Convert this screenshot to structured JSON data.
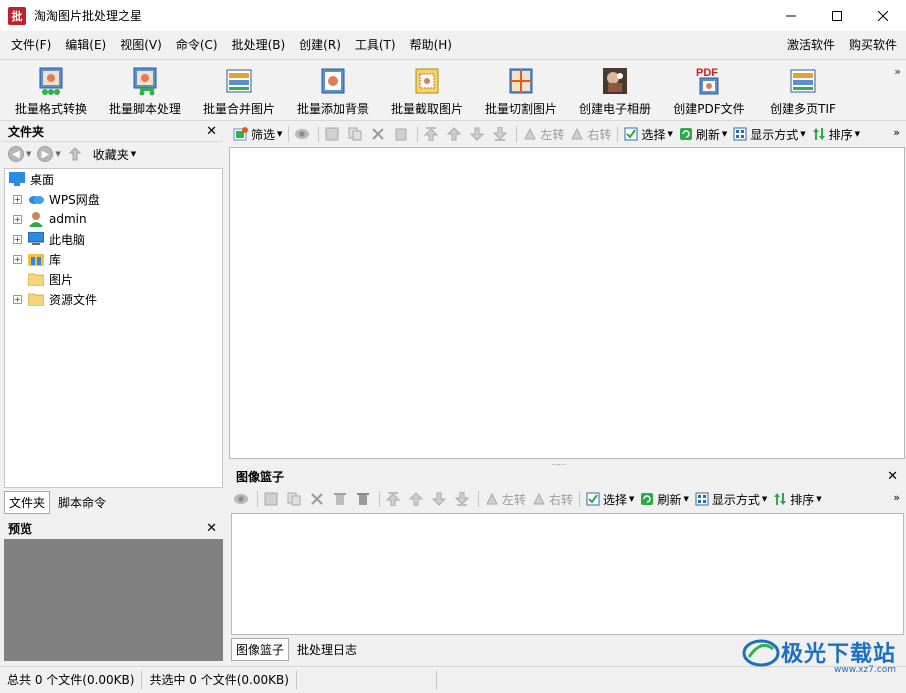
{
  "window": {
    "title": "淘淘图片批处理之星",
    "logo_text": "批",
    "minimize": "minimize",
    "maximize": "maximize",
    "close": "close"
  },
  "menu": {
    "items": [
      "文件(F)",
      "编辑(E)",
      "视图(V)",
      "命令(C)",
      "批处理(B)",
      "创建(R)",
      "工具(T)",
      "帮助(H)"
    ],
    "right": [
      "激活软件",
      "购买软件"
    ]
  },
  "main_toolbar": {
    "buttons": [
      {
        "label": "批量格式转换",
        "icon": "format-convert-icon"
      },
      {
        "label": "批量脚本处理",
        "icon": "script-process-icon"
      },
      {
        "label": "批量合并图片",
        "icon": "merge-images-icon"
      },
      {
        "label": "批量添加背景",
        "icon": "add-background-icon"
      },
      {
        "label": "批量截取图片",
        "icon": "crop-images-icon"
      },
      {
        "label": "批量切割图片",
        "icon": "cut-images-icon"
      },
      {
        "label": "创建电子相册",
        "icon": "photo-album-icon"
      },
      {
        "label": "创建PDF文件",
        "icon": "pdf-icon"
      },
      {
        "label": "创建多页TIF",
        "icon": "multipage-tif-icon"
      }
    ],
    "more": "»"
  },
  "folder_panel": {
    "title": "文件夹",
    "favorites": "收藏夹",
    "tree": [
      {
        "label": "桌面",
        "icon": "desktop-icon",
        "expandable": false,
        "root": true
      },
      {
        "label": "WPS网盘",
        "icon": "cloud-icon",
        "expandable": true
      },
      {
        "label": "admin",
        "icon": "user-icon",
        "expandable": true
      },
      {
        "label": "此电脑",
        "icon": "computer-icon",
        "expandable": true
      },
      {
        "label": "库",
        "icon": "library-icon",
        "expandable": true
      },
      {
        "label": "图片",
        "icon": "folder-icon",
        "expandable": false
      },
      {
        "label": "资源文件",
        "icon": "folder-icon",
        "expandable": true
      }
    ],
    "tabs": [
      "文件夹",
      "脚本命令"
    ]
  },
  "preview_panel": {
    "title": "预览"
  },
  "file_toolbar": {
    "filter": "筛选",
    "rotate_left": "左转",
    "rotate_right": "右转",
    "select": "选择",
    "refresh": "刷新",
    "display_mode": "显示方式",
    "sort": "排序",
    "more": "»"
  },
  "basket_panel": {
    "title": "图像篮子",
    "rotate_left": "左转",
    "rotate_right": "右转",
    "select": "选择",
    "refresh": "刷新",
    "display_mode": "显示方式",
    "sort": "排序",
    "more": "»",
    "tabs": [
      "图像篮子",
      "批处理日志"
    ]
  },
  "statusbar": {
    "total": "总共 0 个文件(0.00KB)",
    "selected": "共选中 0 个文件(0.00KB)"
  },
  "watermark": {
    "text": "极光下载站",
    "url": "www.xz7.com"
  },
  "colors": {
    "accent_blue": "#1d6fbf",
    "logo_red": "#c0202a",
    "preview_gray": "#808080"
  }
}
